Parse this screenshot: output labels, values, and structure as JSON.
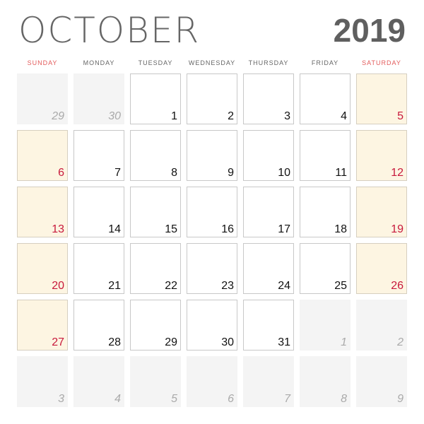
{
  "header": {
    "month": "OCTOBER",
    "year": "2019"
  },
  "weekdays": [
    "SUNDAY",
    "MONDAY",
    "TUESDAY",
    "WEDNESDAY",
    "THURSDAY",
    "FRIDAY",
    "SATURDAY"
  ],
  "colors": {
    "weekend_text": "#c8193c",
    "weekend_fill": "#fdf5e2",
    "header_weekend": "#e35b5b"
  },
  "weeks": [
    [
      {
        "d": "29",
        "t": "other"
      },
      {
        "d": "30",
        "t": "other"
      },
      {
        "d": "1",
        "t": "cur"
      },
      {
        "d": "2",
        "t": "cur"
      },
      {
        "d": "3",
        "t": "cur"
      },
      {
        "d": "4",
        "t": "cur"
      },
      {
        "d": "5",
        "t": "wknd"
      }
    ],
    [
      {
        "d": "6",
        "t": "wknd"
      },
      {
        "d": "7",
        "t": "cur"
      },
      {
        "d": "8",
        "t": "cur"
      },
      {
        "d": "9",
        "t": "cur"
      },
      {
        "d": "10",
        "t": "cur"
      },
      {
        "d": "11",
        "t": "cur"
      },
      {
        "d": "12",
        "t": "wknd"
      }
    ],
    [
      {
        "d": "13",
        "t": "wknd"
      },
      {
        "d": "14",
        "t": "cur"
      },
      {
        "d": "15",
        "t": "cur"
      },
      {
        "d": "16",
        "t": "cur"
      },
      {
        "d": "17",
        "t": "cur"
      },
      {
        "d": "18",
        "t": "cur"
      },
      {
        "d": "19",
        "t": "wknd"
      }
    ],
    [
      {
        "d": "20",
        "t": "wknd"
      },
      {
        "d": "21",
        "t": "cur"
      },
      {
        "d": "22",
        "t": "cur"
      },
      {
        "d": "23",
        "t": "cur"
      },
      {
        "d": "24",
        "t": "cur"
      },
      {
        "d": "25",
        "t": "cur"
      },
      {
        "d": "26",
        "t": "wknd"
      }
    ],
    [
      {
        "d": "27",
        "t": "wknd"
      },
      {
        "d": "28",
        "t": "cur"
      },
      {
        "d": "29",
        "t": "cur"
      },
      {
        "d": "30",
        "t": "cur"
      },
      {
        "d": "31",
        "t": "cur"
      },
      {
        "d": "1",
        "t": "other"
      },
      {
        "d": "2",
        "t": "other"
      }
    ],
    [
      {
        "d": "3",
        "t": "other"
      },
      {
        "d": "4",
        "t": "other"
      },
      {
        "d": "5",
        "t": "other"
      },
      {
        "d": "6",
        "t": "other"
      },
      {
        "d": "7",
        "t": "other"
      },
      {
        "d": "8",
        "t": "other"
      },
      {
        "d": "9",
        "t": "other"
      }
    ]
  ]
}
